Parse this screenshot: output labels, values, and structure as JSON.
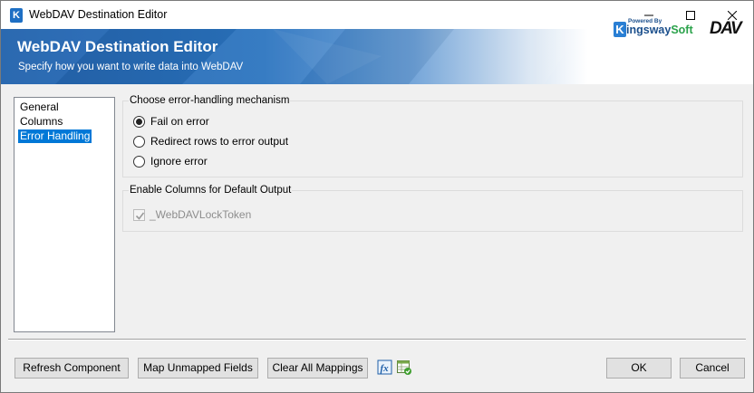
{
  "window": {
    "title": "WebDAV Destination Editor",
    "app_icon_letter": "K"
  },
  "banner": {
    "title": "WebDAV Destination Editor",
    "subtitle": "Specify how you want to write data into WebDAV",
    "kingsway_powered_by": "Powered By",
    "kingsway_k": "K",
    "kingsway_name_main": "ingsway",
    "kingsway_name_accent": "Soft",
    "dav_logo": "DAV"
  },
  "nav": {
    "items": [
      {
        "label": "General",
        "selected": false
      },
      {
        "label": "Columns",
        "selected": false
      },
      {
        "label": "Error Handling",
        "selected": true
      }
    ]
  },
  "error_handling": {
    "title": "Choose error-handling mechanism",
    "options": [
      {
        "label": "Fail on error",
        "checked": true
      },
      {
        "label": "Redirect rows to error output",
        "checked": false
      },
      {
        "label": "Ignore error",
        "checked": false
      }
    ]
  },
  "default_output": {
    "title": "Enable Columns for Default Output",
    "columns": [
      {
        "label": "_WebDAVLockToken",
        "checked": true,
        "enabled": false
      }
    ]
  },
  "footer": {
    "refresh_label": "Refresh Component",
    "map_label": "Map Unmapped Fields",
    "clear_label": "Clear All Mappings",
    "ok_label": "OK",
    "cancel_label": "Cancel"
  },
  "colors": {
    "selection": "#0078d7",
    "banner_blue": "#2363ad",
    "kingsway_blue": "#1b4f8c",
    "kingsway_green": "#2aa24a"
  },
  "icons": {
    "window_controls": [
      "minimize-icon",
      "maximize-icon",
      "close-icon"
    ],
    "toolbar": [
      "fx-expression-icon",
      "grid-check-icon"
    ]
  }
}
